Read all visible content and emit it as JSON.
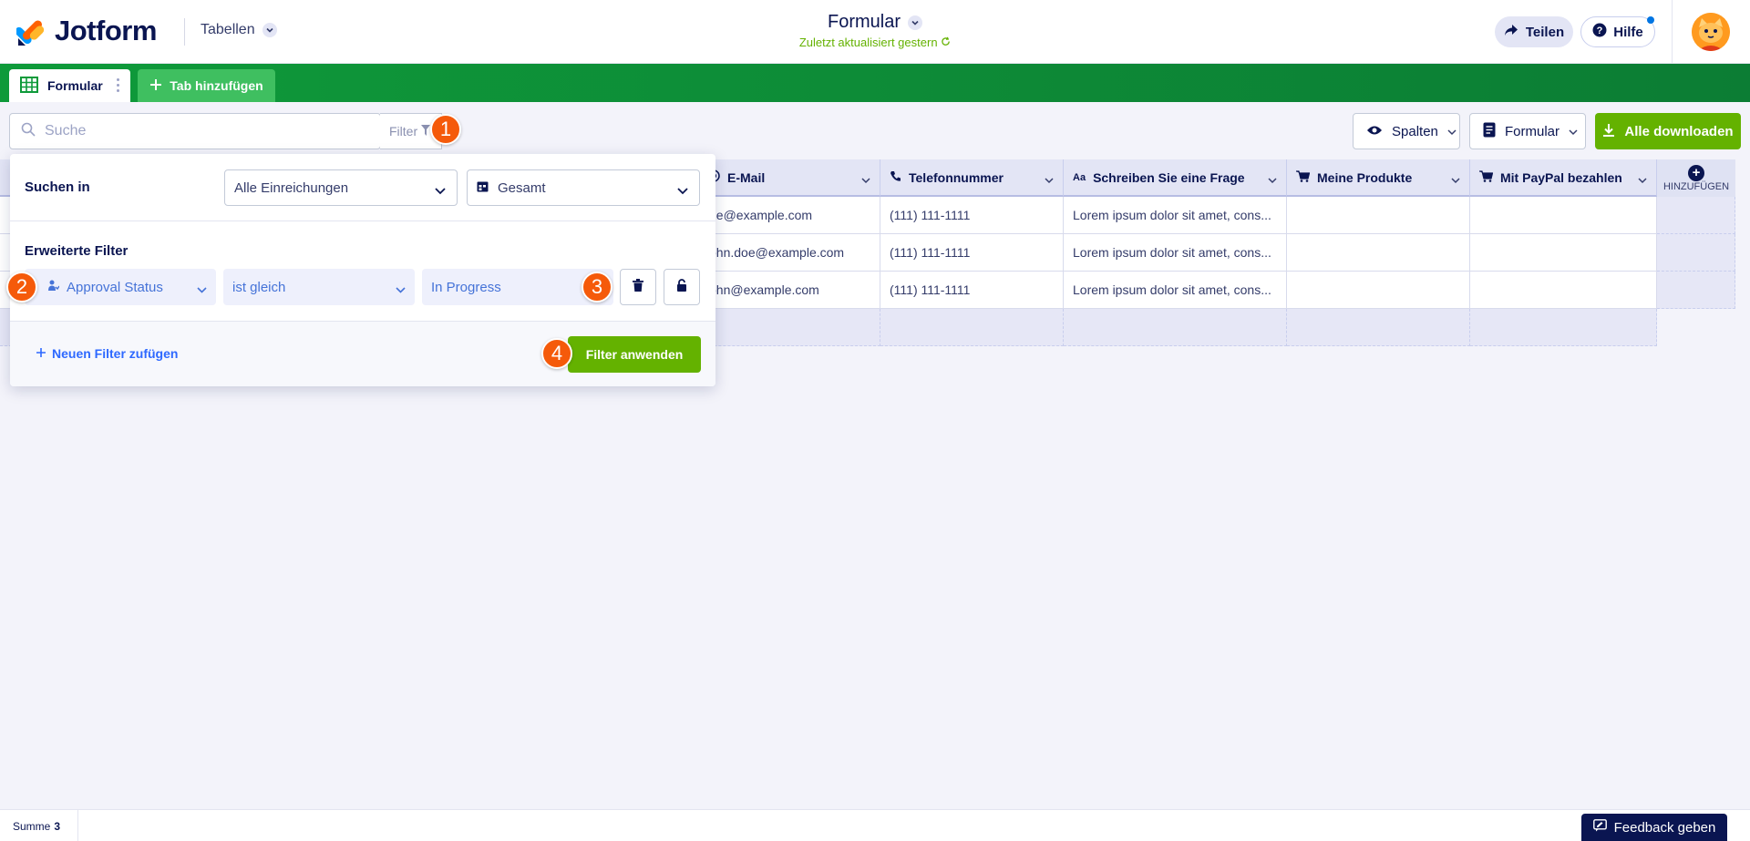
{
  "brand": {
    "name": "Jotform",
    "colors": {
      "navy": "#0a1551",
      "green": "#64b200",
      "orange": "#f55a0a",
      "blue": "#2e69ff"
    }
  },
  "header": {
    "workspace_menu": "Tabellen",
    "title": "Formular",
    "subtitle": "Zuletzt aktualisiert gestern",
    "share_label": "Teilen",
    "help_label": "Hilfe"
  },
  "tabs": {
    "active_label": "Formular",
    "add_label": "Tab hinzufügen"
  },
  "toolbar": {
    "search_placeholder": "Suche",
    "filter_label": "Filter",
    "columns_label": "Spalten",
    "form_label": "Formular",
    "download_label": "Alle downloaden"
  },
  "table": {
    "columns": [
      {
        "label": "E-Mail",
        "icon": "at-icon"
      },
      {
        "label": "Telefonnummer",
        "icon": "phone-icon"
      },
      {
        "label": "Schreiben Sie eine Frage",
        "icon": "text-icon"
      },
      {
        "label": "Meine Produkte",
        "icon": "cart-icon"
      },
      {
        "label": "Mit PayPal bezahlen",
        "icon": "cart-icon"
      }
    ],
    "add_column_label": "HINZUFÜGEN",
    "rows": [
      [
        "ne@example.com",
        "(111) 111-1111",
        "Lorem ipsum dolor sit amet, cons...",
        "",
        ""
      ],
      [
        "ohn.doe@example.com",
        "(111) 111-1111",
        "Lorem ipsum dolor sit amet, cons...",
        "",
        ""
      ],
      [
        "ohn@example.com",
        "(111) 111-1111",
        "Lorem ipsum dolor sit amet, cons...",
        "",
        ""
      ]
    ]
  },
  "filter_panel": {
    "search_in_label": "Suchen in",
    "scope_value": "Alle Einreichungen",
    "date_value": "Gesamt",
    "advanced_label": "Erweiterte Filter",
    "field_value": "Approval Status",
    "operator_value": "ist gleich",
    "condition_value": "In Progress",
    "add_filter_label": "Neuen Filter zufügen",
    "apply_label": "Filter anwenden"
  },
  "annotations": [
    "1",
    "2",
    "3",
    "4"
  ],
  "footer": {
    "sum_label": "Summe",
    "sum_value": "3",
    "feedback_label": "Feedback geben"
  }
}
